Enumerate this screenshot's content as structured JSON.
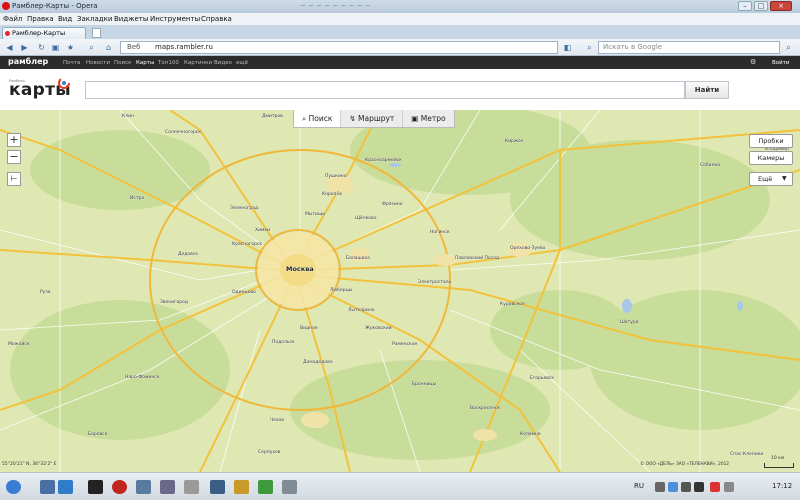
{
  "browser": {
    "title": "Рамблер-Карты - Opera",
    "blurred_title_text": "~ ~ ~ ~ ~ ~ ~ ~ ~",
    "menu": [
      "Файл",
      "Правка",
      "Вид",
      "Закладки",
      "Виджеты",
      "Инструменты",
      "Справка"
    ],
    "tab_label": "Рамблер-Карты",
    "address": "maps.rambler.ru",
    "address_prefix": "Веб",
    "search_placeholder": "Искать в Google"
  },
  "rambler_nav": {
    "logo": "рамблер",
    "links": [
      "Почта",
      "Новости",
      "Поиск",
      "Карты",
      "Топ100",
      "Картинки",
      "Видео",
      "ещё"
    ],
    "active": "Карты",
    "right_link": "Войти"
  },
  "maps": {
    "logo_small": "Рамблер",
    "logo": "карты",
    "search_value": "",
    "find_button": "Найти",
    "modes": [
      "Поиск",
      "Маршрут",
      "Метро"
    ],
    "right_buttons": [
      "Пробки",
      "Камеры",
      "Ещё"
    ],
    "zoom_in": "+",
    "zoom_out": "−",
    "coords": "55°20'21\" N, 36°32'2\" E",
    "copyright": "© ООО «ДЕЛЬ» ЗАО «ТЕЛЕНАВИ», 2012",
    "scale": "10 км",
    "cities": {
      "moscow": "Москва",
      "solnechnogorsk": "Солнечногорск",
      "krasnoarmeysk": "Красноармейск",
      "korolyov": "Королёв",
      "balashikha": "Балашиха",
      "noginsk": "Ногинск",
      "pavlovsky_posad": "Павловский Посад",
      "orekhovo_zuevo": "Орехово-Зуево",
      "kirzhach": "Киржач",
      "mytishchi": "Мытищи",
      "shchyolkovo": "Щёлково",
      "lyubertsy": "Люберцы",
      "zelenograd": "Зеленоград",
      "khimki": "Химки",
      "krasnogorsk": "Красногорск",
      "odintsovo": "Одинцово",
      "podolsk": "Подольск",
      "domodedovo": "Домодедово",
      "vidnoe": "Видное",
      "zhukovsky": "Жуковский",
      "ramenskoe": "Раменское",
      "bronnitsy": "Бронницы",
      "voskresensk": "Воскресенск",
      "kolomna": "Коломна",
      "egoryevsk": "Егорьевск",
      "shatura": "Шатура",
      "naro_fominsk": "Наро-Фоминск",
      "mozhaysk": "Можайск",
      "chekhov": "Чехов",
      "serpukhov": "Серпухов",
      "borovsk": "Боровск",
      "sobinka": "Собинка",
      "vladimir": "Владимир",
      "spas_klepiki": "Спас-Клепики",
      "kurovskoe": "Куровское",
      "istra": "Истра",
      "dedovsk": "Дедовск",
      "pushkino": "Пушкино",
      "fryazino": "Фрязино",
      "elektrostal": "Электросталь",
      "zvenigorod": "Звенигород",
      "ruza": "Руза",
      "klin": "Клин",
      "dmitrov": "Дмитров",
      "sergiev_posad": "Сергиев Посад",
      "lytkarino": "Лыткарино"
    }
  },
  "taskbar": {
    "lang": "RU",
    "clock": "17:12"
  }
}
